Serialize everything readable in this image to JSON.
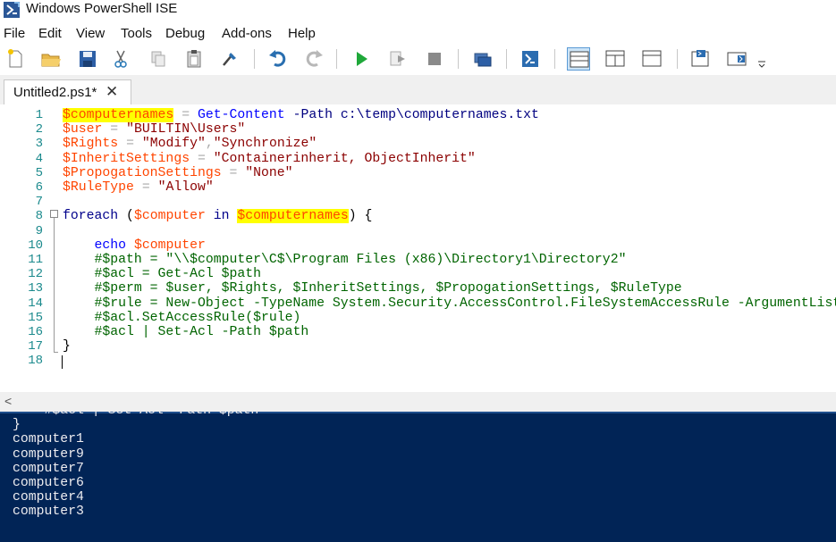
{
  "window": {
    "title": "Windows PowerShell ISE"
  },
  "menu": [
    "File",
    "Edit",
    "View",
    "Tools",
    "Debug",
    "Add-ons",
    "Help"
  ],
  "toolbar": {
    "buttons": [
      "new-file-icon",
      "open-folder-icon",
      "save-icon",
      "cut-icon",
      "copy-icon",
      "paste-icon",
      "clear-console-icon",
      "undo-icon",
      "redo-icon",
      "run-script-icon",
      "run-selection-icon",
      "stop-icon",
      "remote-powershell-icon",
      "powershell-console-icon",
      "show-script-pane-top-icon",
      "show-script-pane-right-icon",
      "show-script-pane-maximized-icon",
      "show-command-window-icon",
      "show-command-addon-icon",
      "overflow-chevron-icon"
    ]
  },
  "tab": {
    "label": "Untitled2.ps1*",
    "close": "✕"
  },
  "editor": {
    "line_numbers": [
      "1",
      "2",
      "3",
      "4",
      "5",
      "6",
      "7",
      "8",
      "9",
      "10",
      "11",
      "12",
      "13",
      "14",
      "15",
      "16",
      "17",
      "18"
    ],
    "highlights": [
      "$computernames"
    ],
    "lines": [
      [
        {
          "t": "$computernames",
          "c": "var",
          "hl": true
        },
        {
          "t": " ",
          "c": "plain"
        },
        {
          "t": "=",
          "c": "op"
        },
        {
          "t": " ",
          "c": "plain"
        },
        {
          "t": "Get-Content",
          "c": "cmd"
        },
        {
          "t": " ",
          "c": "plain"
        },
        {
          "t": "-Path",
          "c": "param"
        },
        {
          "t": " ",
          "c": "plain"
        },
        {
          "t": "c:\\temp\\computernames.txt",
          "c": "param"
        }
      ],
      [
        {
          "t": "$user",
          "c": "var"
        },
        {
          "t": " ",
          "c": "plain"
        },
        {
          "t": "=",
          "c": "op"
        },
        {
          "t": " ",
          "c": "plain"
        },
        {
          "t": "\"BUILTIN\\Users\"",
          "c": "str"
        }
      ],
      [
        {
          "t": "$Rights",
          "c": "var"
        },
        {
          "t": " ",
          "c": "plain"
        },
        {
          "t": "=",
          "c": "op"
        },
        {
          "t": " ",
          "c": "plain"
        },
        {
          "t": "\"Modify\"",
          "c": "str"
        },
        {
          "t": ",",
          "c": "op"
        },
        {
          "t": "\"Synchronize\"",
          "c": "str"
        }
      ],
      [
        {
          "t": "$InheritSettings",
          "c": "var"
        },
        {
          "t": " ",
          "c": "plain"
        },
        {
          "t": "=",
          "c": "op"
        },
        {
          "t": " ",
          "c": "plain"
        },
        {
          "t": "\"Containerinherit, ObjectInherit\"",
          "c": "str"
        }
      ],
      [
        {
          "t": "$PropogationSettings",
          "c": "var"
        },
        {
          "t": " ",
          "c": "plain"
        },
        {
          "t": "=",
          "c": "op"
        },
        {
          "t": " ",
          "c": "plain"
        },
        {
          "t": "\"None\"",
          "c": "str"
        }
      ],
      [
        {
          "t": "$RuleType",
          "c": "var"
        },
        {
          "t": " ",
          "c": "plain"
        },
        {
          "t": "=",
          "c": "op"
        },
        {
          "t": " ",
          "c": "plain"
        },
        {
          "t": "\"Allow\"",
          "c": "str"
        }
      ],
      [],
      [
        {
          "t": "foreach",
          "c": "kw"
        },
        {
          "t": " (",
          "c": "plain"
        },
        {
          "t": "$computer",
          "c": "var"
        },
        {
          "t": " ",
          "c": "plain"
        },
        {
          "t": "in",
          "c": "kw"
        },
        {
          "t": " ",
          "c": "plain"
        },
        {
          "t": "$computernames",
          "c": "var",
          "hl": true
        },
        {
          "t": ") {",
          "c": "plain"
        }
      ],
      [],
      [
        {
          "t": "    ",
          "c": "plain"
        },
        {
          "t": "echo",
          "c": "cmd"
        },
        {
          "t": " ",
          "c": "plain"
        },
        {
          "t": "$computer",
          "c": "var"
        }
      ],
      [
        {
          "t": "    #$path = \"\\\\$computer\\C$\\Program Files (x86)\\Directory1\\Directory2\"",
          "c": "cmt"
        }
      ],
      [
        {
          "t": "    #$acl = Get-Acl $path",
          "c": "cmt"
        }
      ],
      [
        {
          "t": "    #$perm = $user, $Rights, $InheritSettings, $PropogationSettings, $RuleType",
          "c": "cmt"
        }
      ],
      [
        {
          "t": "    #$rule = New-Object -TypeName System.Security.AccessControl.FileSystemAccessRule -ArgumentList $perm",
          "c": "cmt"
        }
      ],
      [
        {
          "t": "    #$acl.SetAccessRule($rule)",
          "c": "cmt"
        }
      ],
      [
        {
          "t": "    #$acl | Set-Acl -Path $path",
          "c": "cmt"
        }
      ],
      [
        {
          "t": "}",
          "c": "plain"
        }
      ],
      []
    ]
  },
  "console": {
    "lines": [
      "    #$acl | Set-Acl -Path $path",
      "}",
      "computer1",
      "computer9",
      "computer7",
      "computer6",
      "computer4",
      "computer3"
    ]
  }
}
